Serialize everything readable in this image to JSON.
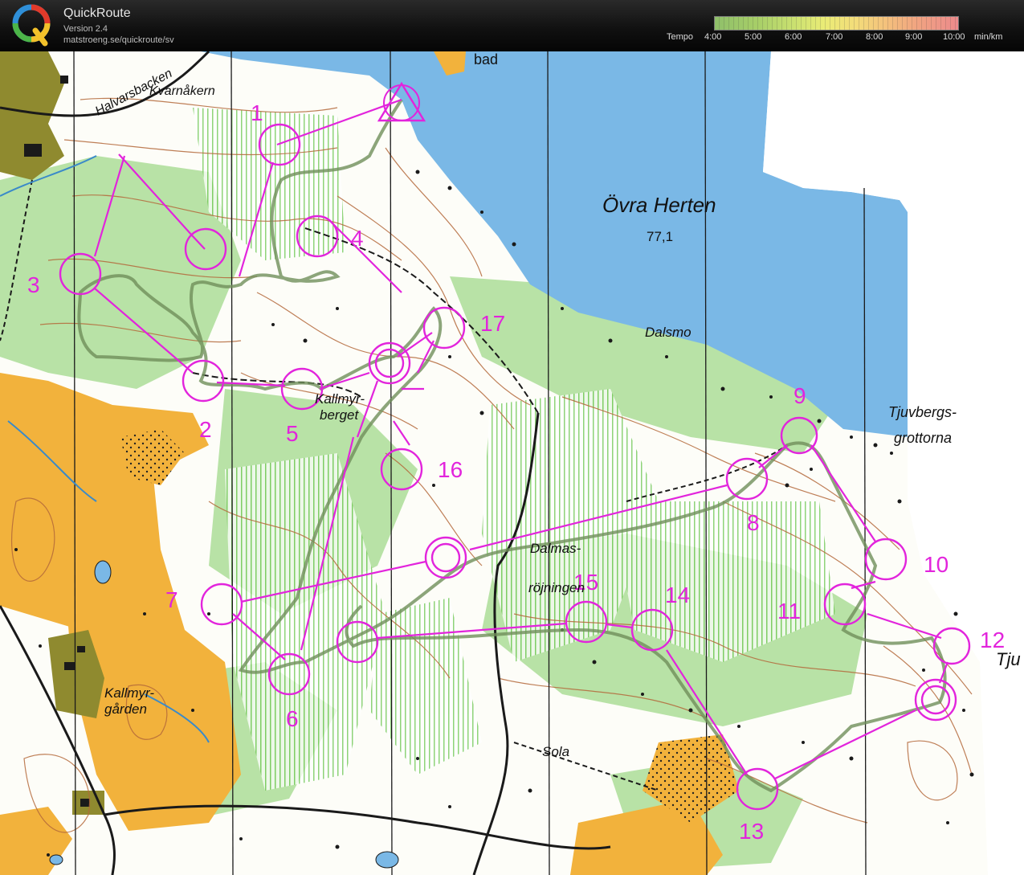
{
  "app": {
    "title": "QuickRoute",
    "version": "Version 2.4",
    "url": "matstroeng.se/quickroute/sv",
    "logo_letter": "Q"
  },
  "legend": {
    "label": "Tempo",
    "ticks": [
      "4:00",
      "5:00",
      "6:00",
      "7:00",
      "8:00",
      "9:00",
      "10:00"
    ],
    "unit": "min/km",
    "colors": [
      "#8fbf6a",
      "#c9e070",
      "#eaec76",
      "#f4c27c",
      "#ec8a8c"
    ]
  },
  "map": {
    "colors": {
      "water": "#7ab8e6",
      "open": "#f2b23c",
      "forest_green": "#b8e2a6",
      "course": "#e224dc",
      "route": "#6f8f5a",
      "contour": "#b4683a"
    },
    "places": {
      "lake_name": "Övra Herten",
      "lake_height": "77,1",
      "bad": "bad",
      "halvarsbacken": "Halvarsbacken",
      "kvarnakern": "Kvarnåkern",
      "dalsmo": "Dalsmo",
      "tjuvbergs_1": "Tjuvbergs-",
      "tjuvbergs_2": "grottorna",
      "kallmyr_1": "Kallmyr-",
      "kallmyr_2": "berget",
      "dalmas_1": "Dalmas-",
      "dalmas_2": "röjningen",
      "kallmyrgarden_1": "Kallmyr-",
      "kallmyrgarden_2": "gården",
      "sola": "Sola",
      "tju": "Tju"
    },
    "controls": [
      "1",
      "2",
      "3",
      "4",
      "5",
      "6",
      "7",
      "8",
      "9",
      "10",
      "11",
      "12",
      "13",
      "14",
      "15",
      "16",
      "17"
    ]
  }
}
